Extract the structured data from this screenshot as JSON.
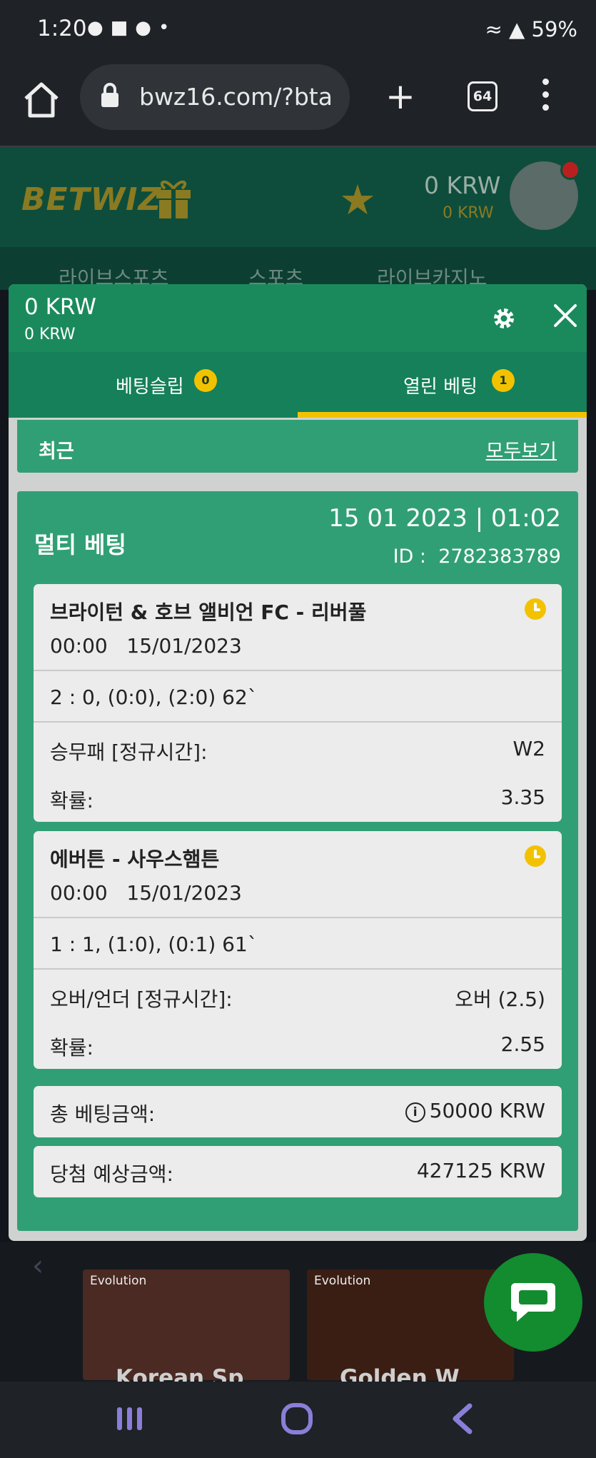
{
  "status": {
    "time": "1:20",
    "right_text": "59%"
  },
  "browser": {
    "url": "bwz16.com/?bta",
    "tab_count": "64"
  },
  "site": {
    "logo_text": "BETWIZ",
    "balance_main": "0 KRW",
    "balance_bonus": "0 KRW",
    "nav": [
      "라이브스포츠",
      "스포츠",
      "라이브카지노"
    ]
  },
  "panel": {
    "balance_main": "0 KRW",
    "balance_bonus": "0 KRW",
    "tabs": [
      {
        "label": "베팅슬립",
        "badge": "0"
      },
      {
        "label": "열린 베팅",
        "badge": "1"
      }
    ],
    "recent_title": "최근",
    "view_all": "모두보기",
    "bet": {
      "type": "멀티 베팅",
      "datetime": "15 01 2023 | 01:02",
      "id_label": "ID :",
      "id": "2782383789",
      "selections": [
        {
          "match": "브라이턴 & 호브 앨비언 FC - 리버풀",
          "time": "00:00",
          "date": "15/01/2023",
          "score": "2 : 0, (0:0), (2:0) 62`",
          "market_label": "승무패 [정규시간]:",
          "market_value": "W2",
          "odds_label": "확률:",
          "odds_value": "3.35"
        },
        {
          "match": "에버튼 - 사우스햄튼",
          "time": "00:00",
          "date": "15/01/2023",
          "score": "1 : 1, (1:0), (0:1) 61`",
          "market_label": "오버/언더 [정규시간]:",
          "market_value": "오버 (2.5)",
          "odds_label": "확률:",
          "odds_value": "2.55"
        }
      ],
      "total_stake_label": "총 베팅금액:",
      "total_stake_value": "50000 KRW",
      "potential_win_label": "당첨 예상금액:",
      "potential_win_value": "427125 KRW"
    }
  },
  "games": [
    {
      "provider": "Evolution",
      "title": "Korean Sp"
    },
    {
      "provider": "Evolution",
      "title": "Golden W"
    }
  ],
  "colors": {
    "accent": "#f2c200",
    "panel_green": "#1a8a5c",
    "card_bg": "#ececec"
  }
}
